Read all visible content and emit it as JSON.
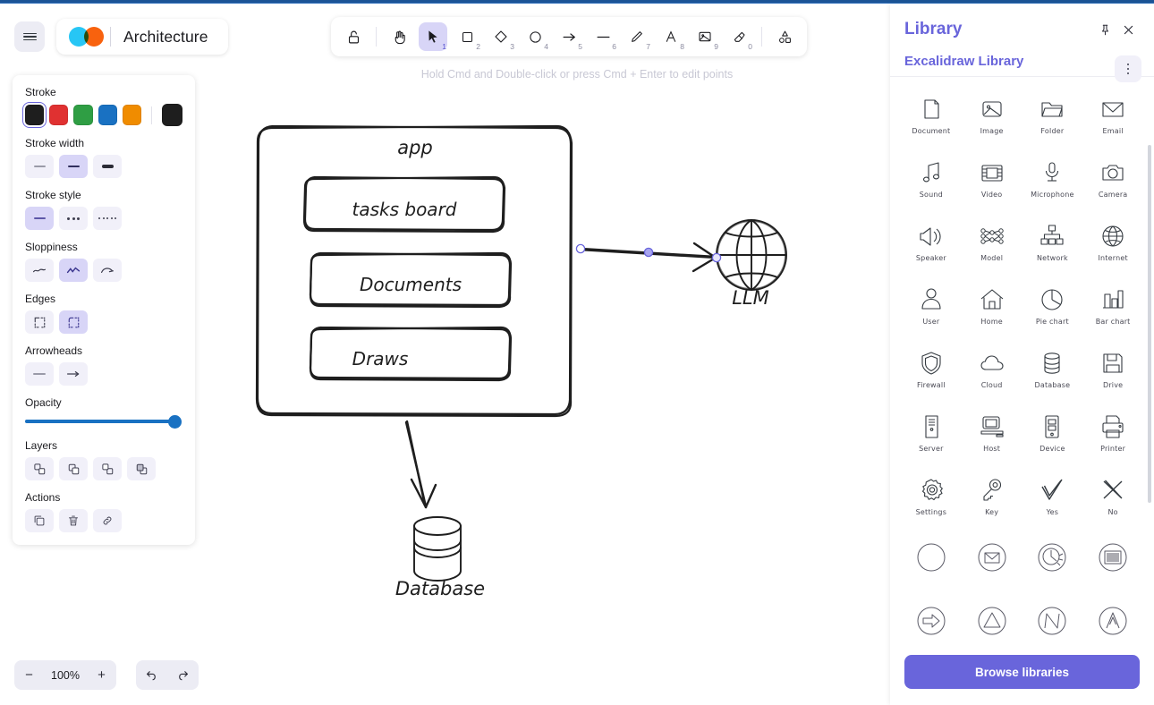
{
  "window": {
    "title": "Architecture"
  },
  "hamburger": {
    "name": "menu-button"
  },
  "hint": {
    "text": "Hold Cmd and Double-click or press Cmd + Enter to edit points"
  },
  "toolbar": {
    "tools": [
      {
        "name": "lock-icon",
        "label": "Keep selected tool active after drawing",
        "key": ""
      },
      {
        "name": "hand-icon",
        "label": "Hand (panning tool)",
        "key": ""
      },
      {
        "name": "selection-icon",
        "label": "Selection",
        "key": "1",
        "active": true
      },
      {
        "name": "rectangle-icon",
        "label": "Rectangle",
        "key": "2"
      },
      {
        "name": "diamond-icon",
        "label": "Diamond",
        "key": "3"
      },
      {
        "name": "ellipse-icon",
        "label": "Ellipse",
        "key": "4"
      },
      {
        "name": "arrow-icon",
        "label": "Arrow",
        "key": "5"
      },
      {
        "name": "line-icon",
        "label": "Line",
        "key": "6"
      },
      {
        "name": "draw-icon",
        "label": "Draw",
        "key": "7"
      },
      {
        "name": "text-icon",
        "label": "Text",
        "key": "8"
      },
      {
        "name": "image-icon",
        "label": "Insert image",
        "key": "9"
      },
      {
        "name": "eraser-icon",
        "label": "Eraser",
        "key": "0"
      },
      {
        "name": "shapes-icon",
        "label": "More tools",
        "key": ""
      }
    ]
  },
  "panel": {
    "sections": {
      "stroke": {
        "label": "Stroke",
        "colors": [
          "#1e1e1e",
          "#e03131",
          "#2f9e44",
          "#1971c2",
          "#f08c00"
        ],
        "selected_index": 0,
        "current": "#1e1e1e"
      },
      "stroke_width": {
        "label": "Stroke width",
        "options": [
          "thin",
          "bold",
          "extra-bold"
        ],
        "selected_index": 1
      },
      "stroke_style": {
        "label": "Stroke style",
        "options": [
          "solid",
          "dashed",
          "dotted"
        ],
        "selected_index": 0
      },
      "sloppiness": {
        "label": "Sloppiness",
        "options": [
          "architect",
          "artist",
          "cartoonist"
        ],
        "selected_index": 1
      },
      "edges": {
        "label": "Edges",
        "options": [
          "sharp",
          "round"
        ],
        "selected_index": 1
      },
      "arrowheads": {
        "label": "Arrowheads",
        "options": [
          "none",
          "arrow"
        ],
        "selected_index": 1
      },
      "opacity": {
        "label": "Opacity",
        "value": 100
      },
      "layers": {
        "label": "Layers",
        "options": [
          "send-to-back",
          "send-backward",
          "bring-forward",
          "bring-to-front"
        ]
      },
      "actions": {
        "label": "Actions",
        "options": [
          "duplicate",
          "delete",
          "copy-link"
        ]
      }
    }
  },
  "zoom": {
    "value": "100%",
    "minus": "−",
    "plus": "+"
  },
  "history": {
    "undo": "undo",
    "redo": "redo"
  },
  "library": {
    "title": "Library",
    "subtitle": "Excalidraw Library",
    "pin_icon": "pin-icon",
    "close_icon": "close-icon",
    "more_icon": "more-options-icon",
    "browse_label": "Browse libraries",
    "items": [
      {
        "icon": "document-icon",
        "label": "Document"
      },
      {
        "icon": "image-icon",
        "label": "Image"
      },
      {
        "icon": "folder-icon",
        "label": "Folder"
      },
      {
        "icon": "email-icon",
        "label": "Email"
      },
      {
        "icon": "sound-icon",
        "label": "Sound"
      },
      {
        "icon": "video-icon",
        "label": "Video"
      },
      {
        "icon": "microphone-icon",
        "label": "Microphone"
      },
      {
        "icon": "camera-icon",
        "label": "Camera"
      },
      {
        "icon": "speaker-icon",
        "label": "Speaker"
      },
      {
        "icon": "model-icon",
        "label": "Model"
      },
      {
        "icon": "network-icon",
        "label": "Network"
      },
      {
        "icon": "internet-icon",
        "label": "Internet"
      },
      {
        "icon": "user-icon",
        "label": "User"
      },
      {
        "icon": "home-icon",
        "label": "Home"
      },
      {
        "icon": "pie-chart-icon",
        "label": "Pie chart"
      },
      {
        "icon": "bar-chart-icon",
        "label": "Bar chart"
      },
      {
        "icon": "firewall-icon",
        "label": "Firewall"
      },
      {
        "icon": "cloud-icon",
        "label": "Cloud"
      },
      {
        "icon": "database-icon",
        "label": "Database"
      },
      {
        "icon": "drive-icon",
        "label": "Drive"
      },
      {
        "icon": "server-icon",
        "label": "Server"
      },
      {
        "icon": "host-icon",
        "label": "Host"
      },
      {
        "icon": "device-icon",
        "label": "Device"
      },
      {
        "icon": "printer-icon",
        "label": "Printer"
      },
      {
        "icon": "settings-icon",
        "label": "Settings"
      },
      {
        "icon": "key-icon",
        "label": "Key"
      },
      {
        "icon": "yes-check-icon",
        "label": "Yes"
      },
      {
        "icon": "no-cross-icon",
        "label": "No"
      },
      {
        "icon": "circle-blank-icon",
        "label": ""
      },
      {
        "icon": "circle-email-icon",
        "label": ""
      },
      {
        "icon": "circle-clock-icon",
        "label": ""
      },
      {
        "icon": "circle-list-icon",
        "label": ""
      },
      {
        "icon": "circle-arrow-icon",
        "label": ""
      },
      {
        "icon": "circle-triangle-icon",
        "label": ""
      },
      {
        "icon": "circle-zigzag-icon",
        "label": ""
      },
      {
        "icon": "circle-caret-icon",
        "label": ""
      }
    ]
  },
  "canvas": {
    "nodes": [
      {
        "name": "app-container",
        "label": "app"
      },
      {
        "name": "tasks-board-box",
        "label": "tasks board"
      },
      {
        "name": "documents-box",
        "label": "Documents"
      },
      {
        "name": "draws-box",
        "label": "Draws"
      },
      {
        "name": "llm-globe",
        "label": "LLM"
      },
      {
        "name": "database-cylinder",
        "label": "Database"
      }
    ]
  }
}
